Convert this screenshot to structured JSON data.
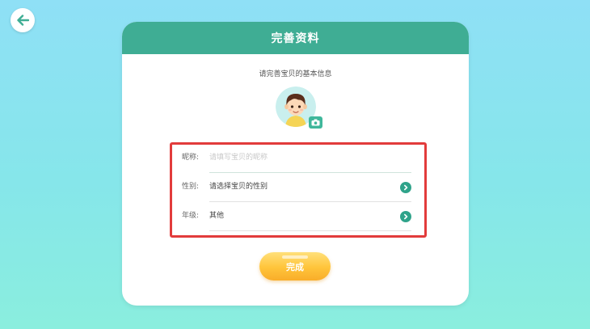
{
  "header": {
    "title": "完善资料"
  },
  "subtitle": "请完善宝贝的基本信息",
  "form": {
    "nickname": {
      "label": "昵称:",
      "placeholder": "请填写宝贝的昵称"
    },
    "gender": {
      "label": "性别:",
      "value": "请选择宝贝的性别"
    },
    "grade": {
      "label": "年级:",
      "value": "其他"
    }
  },
  "done_button": {
    "label": "完成"
  },
  "icons": {
    "back": "arrow-left-icon",
    "camera": "camera-icon",
    "chevron": "chevron-right-icon"
  },
  "colors": {
    "header": "#3fad94",
    "highlight_border": "#e23b3b",
    "button": "#ffc43a",
    "chevron": "#2fa38a"
  }
}
